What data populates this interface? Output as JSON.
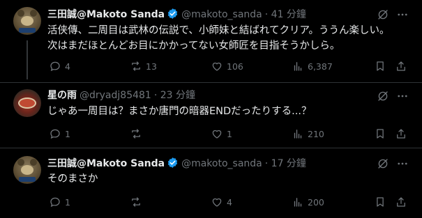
{
  "tweets": [
    {
      "name": "三田誠@Makoto Sanda",
      "handle": "@makoto_sanda",
      "time": "· 41 分鐘",
      "verified": true,
      "lines": [
        "活侠傳、二周目は武林の伝説で、小師妹と結ばれてクリア。ううん楽しい。",
        "次はまだほとんどお目にかかってない女師匠を目指そうかしら。"
      ],
      "stats": {
        "replies": "4",
        "reposts": "13",
        "likes": "106",
        "views": "6,387"
      }
    },
    {
      "name": "星の雨",
      "handle": "@dryadj85481",
      "time": "· 23 分鐘",
      "verified": false,
      "lines": [
        "じゃあ一周目は？まさか唐門の暗器ENDだったりする...？"
      ],
      "stats": {
        "replies": "1",
        "reposts": "",
        "likes": "1",
        "views": "210"
      }
    },
    {
      "name": "三田誠@Makoto Sanda",
      "handle": "@makoto_sanda",
      "time": "· 17 分鐘",
      "verified": true,
      "lines": [
        "そのまさか"
      ],
      "stats": {
        "replies": "1",
        "reposts": "",
        "likes": "4",
        "views": "200"
      }
    }
  ],
  "colors": {
    "background": "#000000",
    "text": "#e7e9ea",
    "muted": "#71767b",
    "verified": "#1d9bf0",
    "divider": "#2f3336"
  }
}
